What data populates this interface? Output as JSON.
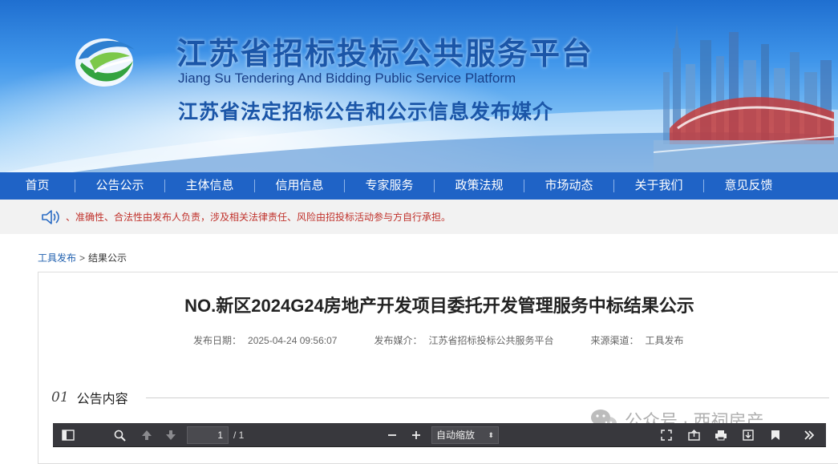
{
  "header": {
    "title_cn": "江苏省招标投标公共服务平台",
    "title_en": "Jiang Su Tendering And Bidding Public Service Platform",
    "media_title": "江苏省法定招标公告和公示信息发布媒介"
  },
  "nav": {
    "items": [
      "首页",
      "公告公示",
      "主体信息",
      "信用信息",
      "专家服务",
      "政策法规",
      "市场动态",
      "关于我们",
      "意见反馈"
    ]
  },
  "notice": {
    "text": "、准确性、合法性由发布人负责，涉及相关法律责任、风险由招投标活动参与方自行承担。"
  },
  "breadcrumb": {
    "items": [
      "工具发布",
      "结果公示"
    ],
    "separator": ">"
  },
  "document": {
    "title": "NO.新区2024G24房地产开发项目委托开发管理服务中标结果公示",
    "publish_date_label": "发布日期：",
    "publish_date": "2025-04-24 09:56:07",
    "media_label": "发布媒介：",
    "media": "江苏省招标投标公共服务平台",
    "source_label": "来源渠道：",
    "source": "工具发布"
  },
  "section": {
    "number": "01",
    "title": "公告内容"
  },
  "watermark": {
    "text": "公众号 · 西祠房产"
  },
  "pdf_toolbar": {
    "current_page": "1",
    "total_pages": "/ 1",
    "zoom": "自动缩放"
  },
  "colors": {
    "nav_bg": "#1f63c6",
    "notice_text": "#c0312b",
    "toolbar_bg": "#38383d"
  }
}
